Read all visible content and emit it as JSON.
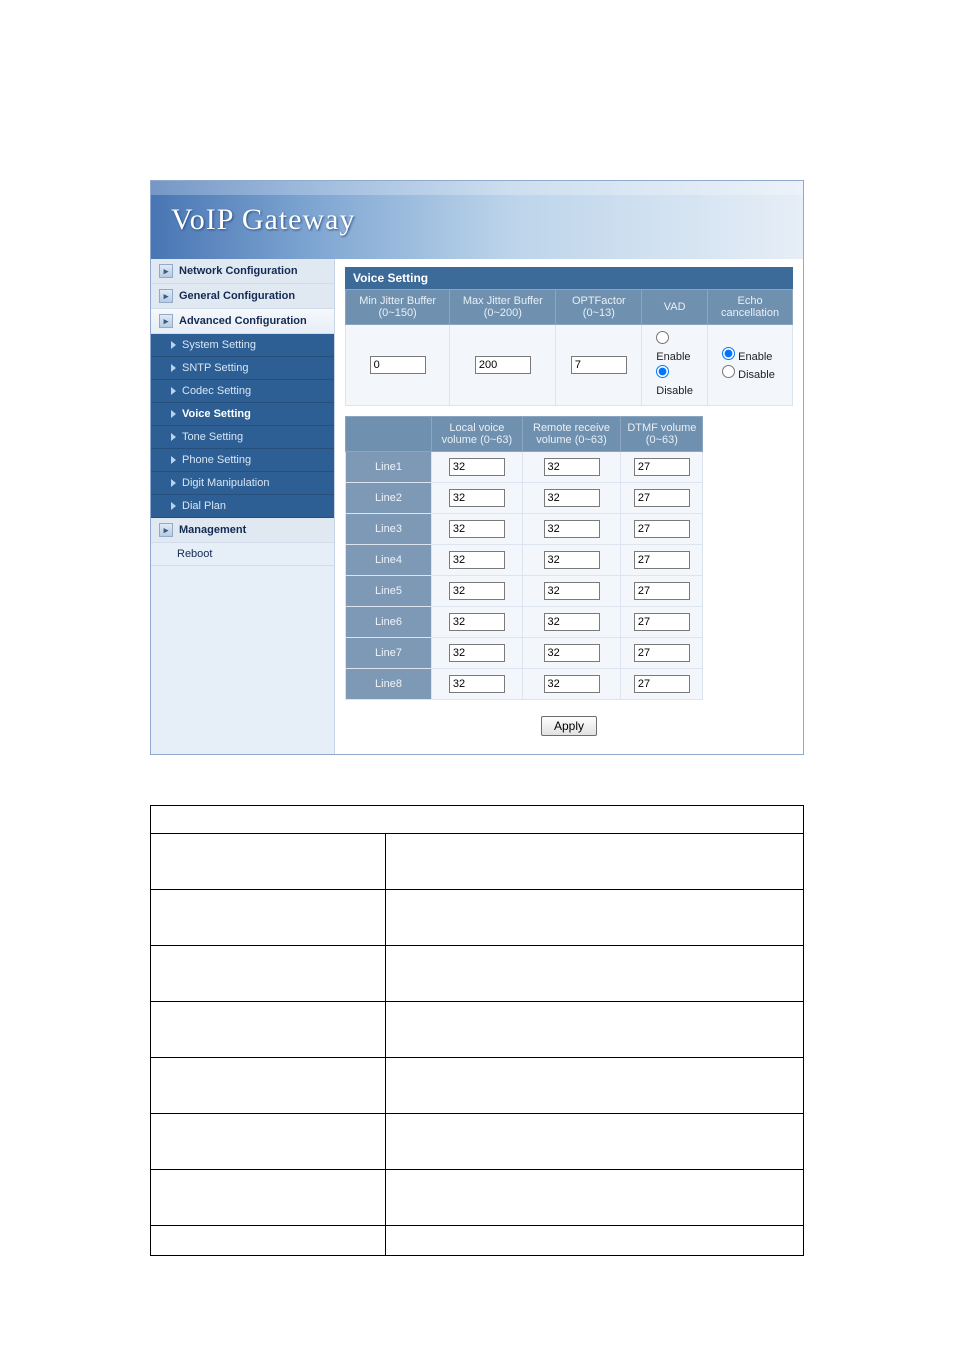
{
  "banner": {
    "title": "VoIP  Gateway"
  },
  "sidebar": {
    "sections": [
      {
        "label": "Network Configuration"
      },
      {
        "label": "General Configuration"
      },
      {
        "label": "Advanced Configuration"
      }
    ],
    "advanced_items": [
      {
        "label": "System Setting"
      },
      {
        "label": "SNTP Setting"
      },
      {
        "label": "Codec Setting"
      },
      {
        "label": "Voice Setting",
        "selected": true
      },
      {
        "label": "Tone Setting"
      },
      {
        "label": "Phone Setting"
      },
      {
        "label": "Digit Manipulation"
      },
      {
        "label": "Dial Plan"
      }
    ],
    "management": "Management",
    "reboot": "Reboot"
  },
  "panel": {
    "title": "Voice Setting",
    "headers": {
      "min_jitter": "Min Jitter Buffer (0~150)",
      "max_jitter": "Max Jitter Buffer (0~200)",
      "optfactor": "OPTFactor (0~13)",
      "vad": "VAD",
      "echo": "Echo cancellation"
    },
    "values": {
      "min_jitter": "0",
      "max_jitter": "200",
      "optfactor": "7",
      "vad": "Disable",
      "echo": "Enable"
    },
    "radio_labels": {
      "enable": "Enable",
      "disable": "Disable"
    },
    "vol_headers": {
      "line": "",
      "local": "Local voice volume (0~63)",
      "remote": "Remote receive volume (0~63)",
      "dtmf": "DTMF volume (0~63)"
    },
    "lines": [
      {
        "name": "Line1",
        "local": "32",
        "remote": "32",
        "dtmf": "27"
      },
      {
        "name": "Line2",
        "local": "32",
        "remote": "32",
        "dtmf": "27"
      },
      {
        "name": "Line3",
        "local": "32",
        "remote": "32",
        "dtmf": "27"
      },
      {
        "name": "Line4",
        "local": "32",
        "remote": "32",
        "dtmf": "27"
      },
      {
        "name": "Line5",
        "local": "32",
        "remote": "32",
        "dtmf": "27"
      },
      {
        "name": "Line6",
        "local": "32",
        "remote": "32",
        "dtmf": "27"
      },
      {
        "name": "Line7",
        "local": "32",
        "remote": "32",
        "dtmf": "27"
      },
      {
        "name": "Line8",
        "local": "32",
        "remote": "32",
        "dtmf": "27"
      }
    ],
    "apply": "Apply"
  }
}
